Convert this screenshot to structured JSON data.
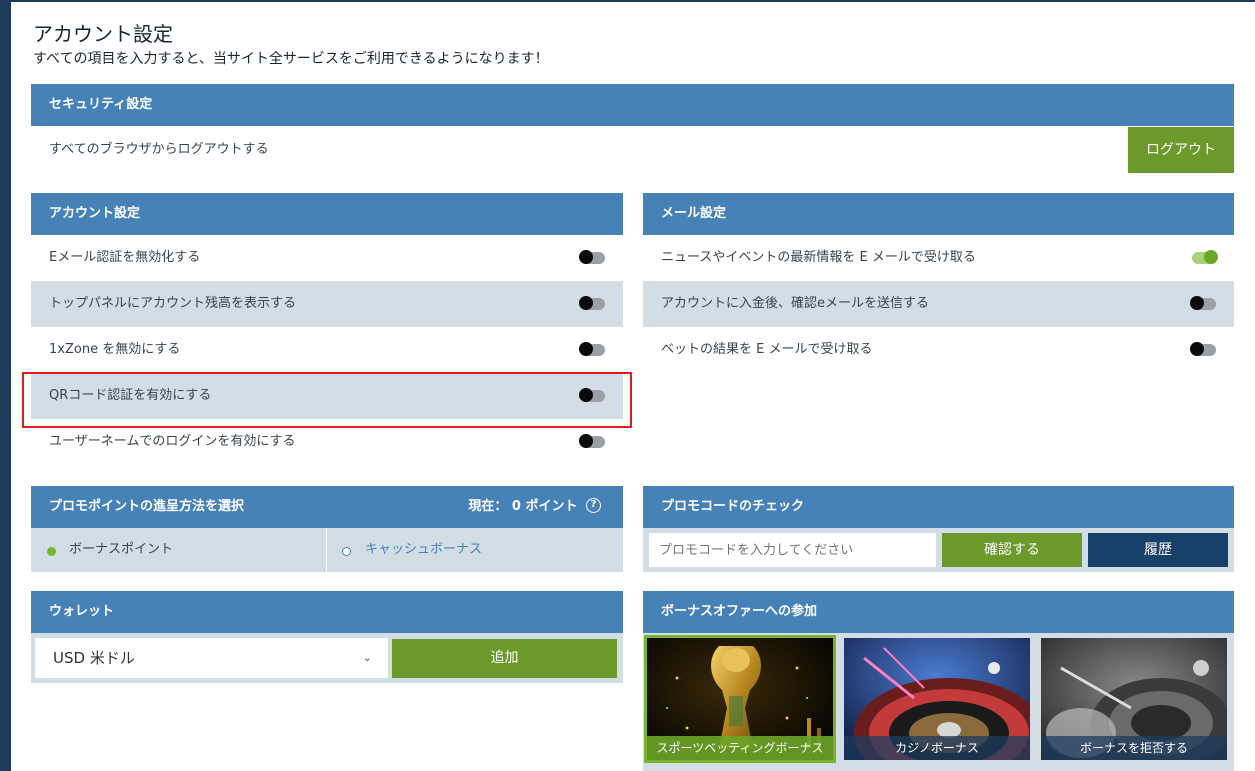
{
  "header": {
    "title": "アカウント設定",
    "subtitle": "すべての項目を入力すると、当サイト全サービスをご利用できるようになります！"
  },
  "security": {
    "heading": "セキュリティ設定",
    "logout_text": "すべてのブラウザからログアウトする",
    "logout_button": "ログアウト"
  },
  "account_settings": {
    "heading": "アカウント設定",
    "items": [
      {
        "label": "Eメール認証を無効化する",
        "on": false
      },
      {
        "label": "トップパネルにアカウント残高を表示する",
        "on": false
      },
      {
        "label": "1xZone を無効にする",
        "on": false
      },
      {
        "label": "QRコード認証を有効にする",
        "on": false
      },
      {
        "label": "ユーザーネームでのログインを有効にする",
        "on": false
      }
    ]
  },
  "mail_settings": {
    "heading": "メール設定",
    "items": [
      {
        "label": "ニュースやイベントの最新情報を E メールで受け取る",
        "on": true
      },
      {
        "label": "アカウントに入金後、確認eメールを送信する",
        "on": false
      },
      {
        "label": "ベットの結果を E メールで受け取る",
        "on": false
      }
    ]
  },
  "promo_points": {
    "heading": "プロモポイントの進呈方法を選択",
    "current_label": "現在：",
    "current_value": "0",
    "current_unit": "ポイント",
    "help_icon": "?",
    "options": [
      {
        "label": "ボーナスポイント",
        "selected": true
      },
      {
        "label": "キャッシュボーナス",
        "selected": false
      }
    ]
  },
  "promo_code": {
    "heading": "プロモコードのチェック",
    "placeholder": "プロモコードを入力してください",
    "confirm_button": "確認する",
    "history_button": "履歴"
  },
  "wallet": {
    "heading": "ウォレット",
    "currency_selected": "USD 米ドル",
    "add_button": "追加"
  },
  "bonus_offer": {
    "heading": "ボーナスオファーへの参加",
    "tiles": [
      {
        "label": "スポーツベッティングボーナス",
        "selected": true
      },
      {
        "label": "カジノボーナス",
        "selected": false
      },
      {
        "label": "ボーナスを拒否する",
        "selected": false
      }
    ]
  },
  "colors": {
    "header_blue": "#4681b8",
    "row_alt": "#d2dde6",
    "green_button": "#6b9a2a",
    "navy_button": "#17406a",
    "highlight_red": "#e01b1b",
    "toggle_on": "#6aa82a"
  }
}
